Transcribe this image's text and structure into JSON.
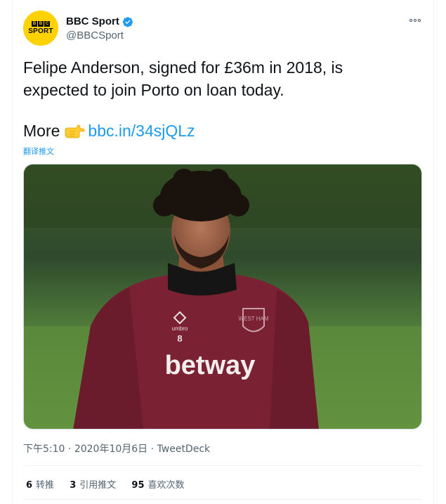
{
  "author": {
    "display_name": "BBC Sport",
    "handle": "@BBCSport",
    "verified": true,
    "avatar_letters": [
      "B",
      "B",
      "C"
    ],
    "avatar_word": "SPORT",
    "avatar_color": "#fdd200"
  },
  "more_icon": "more-horizontal-icon",
  "tweet": {
    "line1": "Felipe Anderson, signed for £36m in 2018, is",
    "line2": "expected to join Porto on loan today.",
    "more_label": "More",
    "emoji": "backhand-index-pointing-right-icon",
    "link": "bbc.in/34sjQLz"
  },
  "translate_label": "翻译推文",
  "media": {
    "jersey_brand": "umbro",
    "jersey_number": "8",
    "sponsor": "betway",
    "crest_text": "WEST HAM"
  },
  "meta": {
    "time": "下午5:10",
    "separator": "·",
    "date": "2020年10月6日",
    "source": "TweetDeck"
  },
  "stats": {
    "retweets_count": "6",
    "retweets_label": "转推",
    "quotes_count": "3",
    "quotes_label": "引用推文",
    "likes_count": "95",
    "likes_label": "喜欢次数"
  },
  "colors": {
    "link": "#1d9bf0",
    "secondary_text": "#536471",
    "primary_text": "#0f1419",
    "divider": "#eff3f4"
  }
}
